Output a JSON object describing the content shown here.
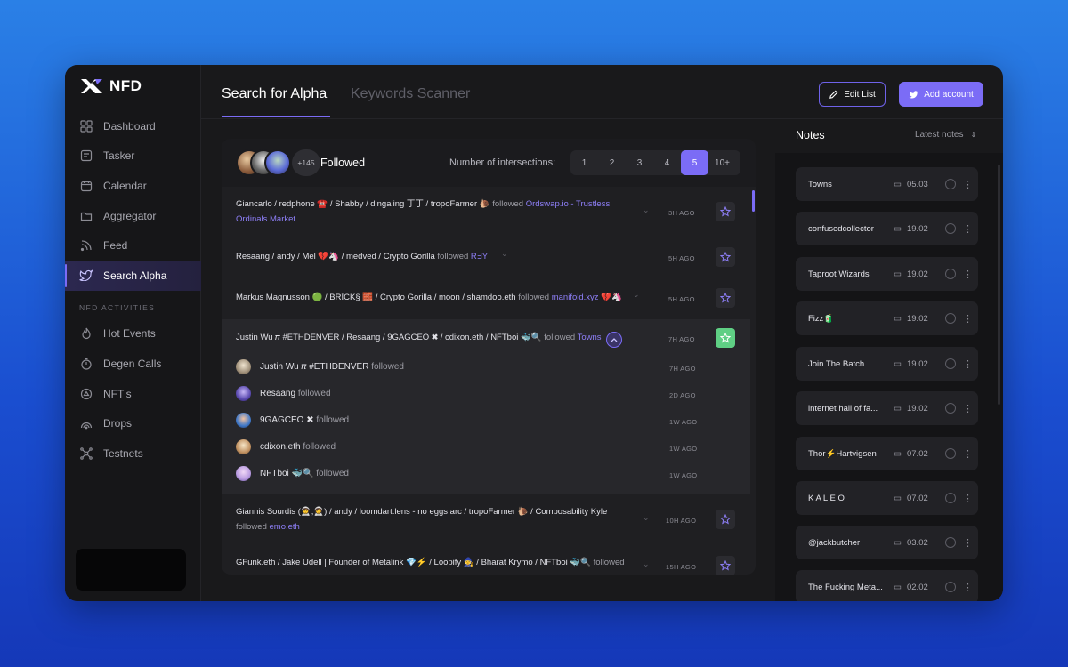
{
  "app": {
    "logo_text": "NFD"
  },
  "sidebar": {
    "items": [
      {
        "label": "Dashboard",
        "icon": "grid-icon"
      },
      {
        "label": "Tasker",
        "icon": "checklist-icon"
      },
      {
        "label": "Calendar",
        "icon": "calendar-icon"
      },
      {
        "label": "Aggregator",
        "icon": "folder-icon"
      },
      {
        "label": "Feed",
        "icon": "rss-icon"
      },
      {
        "label": "Search Alpha",
        "icon": "twitter-icon",
        "active": true
      }
    ],
    "section_label": "NFD ACTIVITIES",
    "activities": [
      {
        "label": "Hot Events",
        "icon": "flame-icon"
      },
      {
        "label": "Degen Calls",
        "icon": "timer-icon"
      },
      {
        "label": "NFT's",
        "icon": "nft-icon"
      },
      {
        "label": "Drops",
        "icon": "drops-icon"
      },
      {
        "label": "Testnets",
        "icon": "network-icon"
      }
    ]
  },
  "header": {
    "tabs": [
      {
        "label": "Search for Alpha",
        "active": true
      },
      {
        "label": "Keywords Scanner",
        "active": false
      }
    ],
    "edit_label": "Edit List",
    "add_label": "Add account"
  },
  "panel": {
    "avatar_count": "+145",
    "followed_label": "Followed",
    "intersections_label": "Number of intersections:",
    "intersections": [
      "1",
      "2",
      "3",
      "4",
      "5",
      "10+"
    ],
    "selected_intersection": "5",
    "rows": [
      {
        "who": "Giancarlo / redphone ☎️ / Shabby / dingaling 丁丁 / tropoFarmer 🐌",
        "verb": "followed",
        "target": "Ordswap.io - Trustless",
        "target2": "Ordinals Market",
        "time": "3H AGO"
      },
      {
        "who": "Resaang / andy / Mel 💔🦄 / medved / Crypto Gorilla",
        "verb": "followed",
        "target": "R∃Y",
        "time": "5H AGO"
      },
      {
        "who": "Markus Magnusson 🟢 / BRĪCK§ 🧱 / Crypto Gorilla / moon / shamdoo.eth",
        "verb": "followed",
        "target": "manifold.xyz",
        "tail": "💔🦄",
        "time": "5H AGO"
      },
      {
        "who": "Justin Wu 𝜋 #ETHDENVER / Resaang / 9GAGCEO ✖ / cdixon.eth / NFTboi 🐳🔍",
        "verb": "followed",
        "target": "Towns",
        "time": "7H AGO"
      },
      {
        "who": "Giannis Sourdis (🧑‍🚀,🧑‍🚀) / andy / loomdart.lens - no eggs arc / tropoFarmer 🐌 / Composability Kyle",
        "verb": "followed",
        "target": "emo.eth",
        "time": "10H AGO"
      },
      {
        "who": "GFunk.eth / Jake Udell | Founder of Metalink 💎⚡ / Loopify 🧙 / Bharat Krymo / NFTboi 🐳🔍",
        "verb": "followed",
        "time": "15H AGO"
      }
    ],
    "sub_rows": [
      {
        "name": "Justin Wu 𝜋 #ETHDENVER",
        "verb": "followed",
        "time": "7H AGO"
      },
      {
        "name": "Resaang",
        "verb": "followed",
        "time": "2D AGO"
      },
      {
        "name": "9GAGCEO ✖",
        "verb": "followed",
        "time": "1W AGO"
      },
      {
        "name": "cdixon.eth",
        "verb": "followed",
        "time": "1W AGO"
      },
      {
        "name": "NFTboi 🐳🔍",
        "verb": "followed",
        "time": "1W AGO"
      }
    ]
  },
  "notes": {
    "title": "Notes",
    "sort_label": "Latest notes",
    "items": [
      {
        "title": "Towns",
        "date": "05.03"
      },
      {
        "title": "confusedcollector",
        "date": "19.02"
      },
      {
        "title": "Taproot Wizards",
        "date": "19.02"
      },
      {
        "title": "Fizz🧃",
        "date": "19.02"
      },
      {
        "title": "Join The Batch",
        "date": "19.02"
      },
      {
        "title": "internet hall of fa...",
        "date": "19.02"
      },
      {
        "title": "Thor⚡Hartvigsen",
        "date": "07.02"
      },
      {
        "title": "K A L E O",
        "date": "07.02"
      },
      {
        "title": "@jackbutcher",
        "date": "03.02"
      },
      {
        "title": "The Fucking Meta...",
        "date": "02.02"
      }
    ]
  },
  "colors": {
    "accent": "#7b6cf6",
    "success": "#5fcf84"
  }
}
